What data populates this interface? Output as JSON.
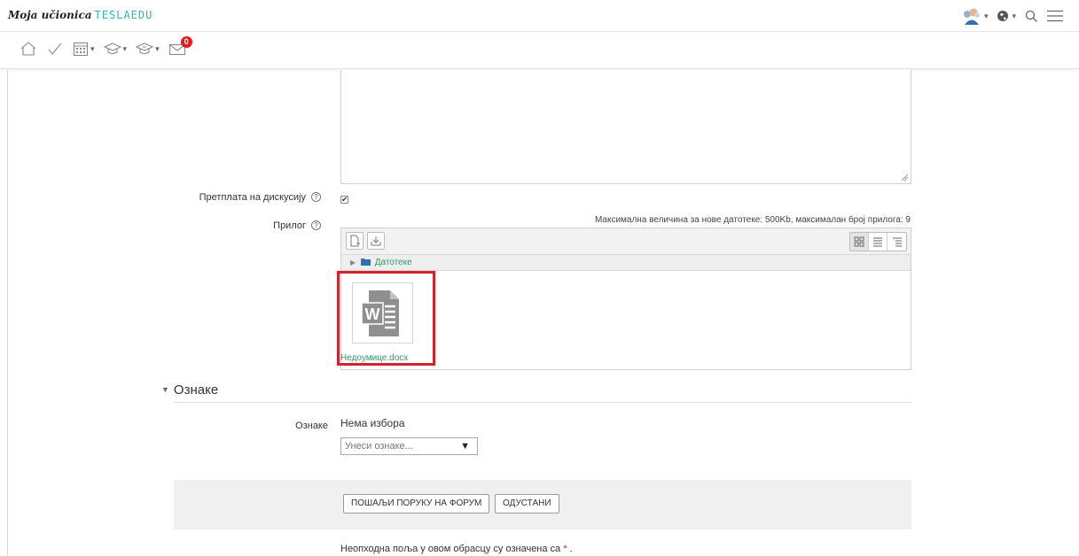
{
  "header": {
    "brand_script": "Moja učionica",
    "brand_tesla": "TESLAEDU",
    "icons": [
      "user-avatar",
      "globe-icon",
      "search-icon",
      "menu-icon"
    ]
  },
  "nav": {
    "icons": [
      "home-icon",
      "check-icon",
      "calendar-icon",
      "graduation-cap-icon",
      "graduation-cap-outline-icon",
      "mail-icon"
    ],
    "messages_count": "0"
  },
  "form": {
    "subscribe_label": "Претплата на дискусију",
    "subscribe_checked": true,
    "attachment_label": "Прилог",
    "max_size_note": "Максимална величина за нове датотеке: 500Kb, максималан број прилога: 9",
    "filepicker": {
      "path_folder": "Датотеке",
      "file_name": "Недоумице.docx",
      "file_icon": "word-document-icon"
    }
  },
  "tags_section": {
    "title": "Ознаке",
    "field_label": "Ознаке",
    "no_selection": "Нема избора",
    "input_placeholder": "Унеси ознаке..."
  },
  "actions": {
    "submit_label": "ПОШАЉИ ПОРУКУ НА ФОРУМ",
    "cancel_label": "ОДУСТАНИ"
  },
  "footer": {
    "required_note": "Неопходна поља у овом обрасцу су означена са",
    "required_star": "*",
    "required_end": "."
  },
  "colors": {
    "accent_green": "#2e9a6c",
    "highlight_red": "#d6202a",
    "badge_red": "#e21b1b"
  }
}
